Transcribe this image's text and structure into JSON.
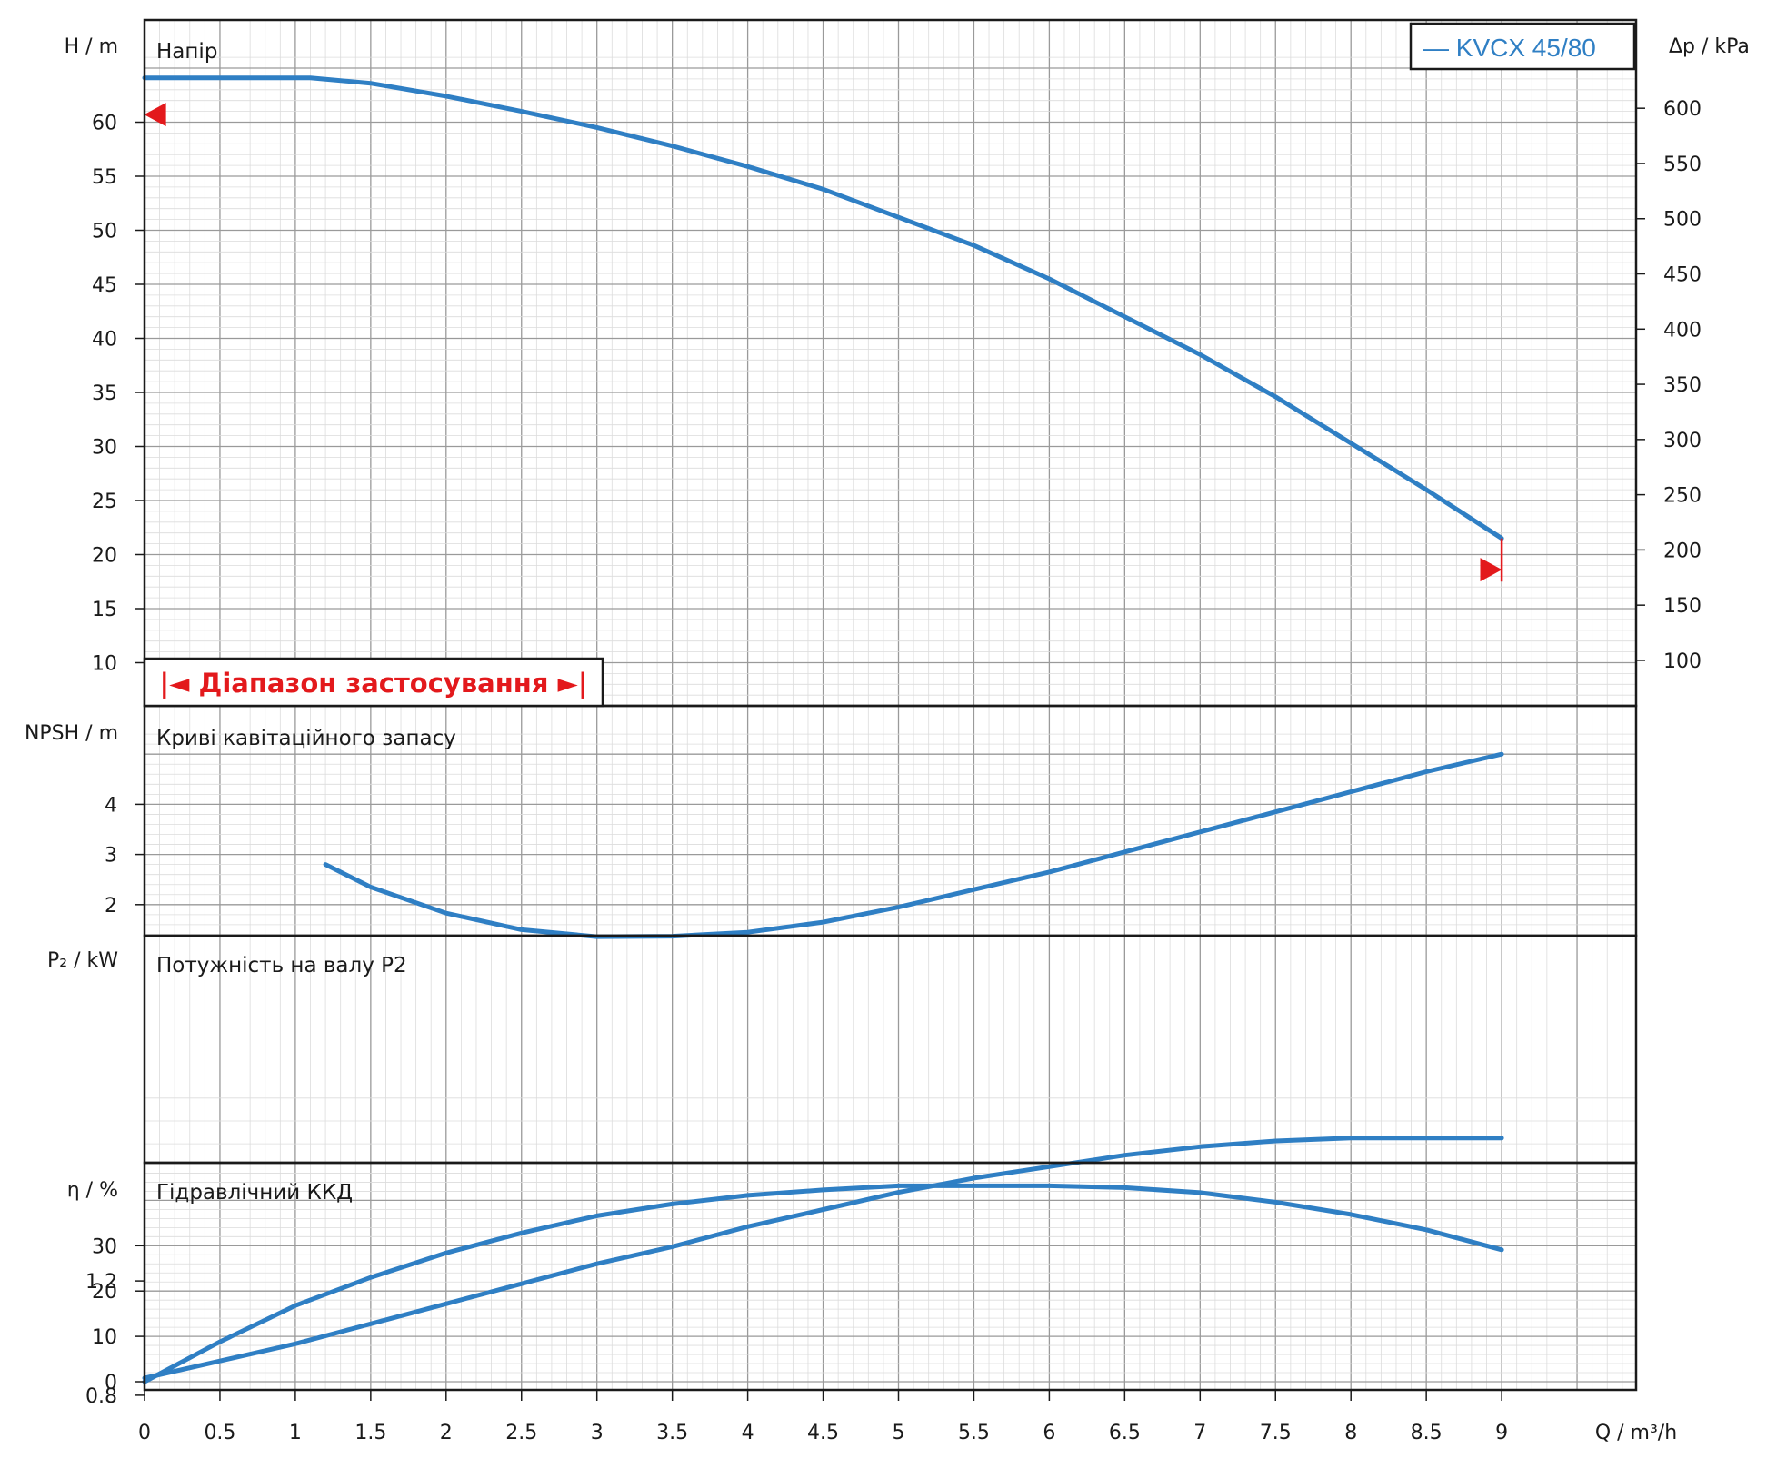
{
  "chart_data": {
    "type": "line",
    "colors": {
      "curve": "#2f7fc4",
      "range": "#e3191c",
      "grid": "#b4b4b4",
      "frame": "#1a1a1a"
    },
    "x": {
      "label": "Q / m³/h",
      "ticks": [
        0,
        0.5,
        1,
        1.5,
        2,
        2.5,
        3,
        3.5,
        4,
        4.5,
        5,
        5.5,
        6,
        6.5,
        7,
        7.5,
        8,
        8.5,
        9
      ],
      "tick_labels": [
        "0",
        "0.5",
        "1",
        "1.5",
        "2",
        "2.5",
        "3",
        "3.5",
        "4",
        "4.5",
        "5",
        "5.5",
        "6",
        "6.5",
        "7",
        "7.5",
        "8",
        "8.5",
        "9"
      ],
      "range": [
        0,
        10
      ]
    },
    "legend": {
      "label": "— KVCX 45/80",
      "position": "top-right"
    },
    "application_range": {
      "label": "|◄ Діапазон застосування ►|",
      "q_min": 0,
      "q_max": 9
    },
    "panels": [
      {
        "id": "head",
        "title": "Напір",
        "ylabel": "H / m",
        "ylim": [
          5,
          66
        ],
        "yticks": [
          10,
          15,
          20,
          25,
          30,
          35,
          40,
          45,
          50,
          55,
          60
        ],
        "ytick_labels": [
          "10",
          "15",
          "20",
          "25",
          "30",
          "35",
          "40",
          "45",
          "50",
          "55",
          "60"
        ],
        "secondary_axis": {
          "label": "Δp / kPa",
          "ticks": [
            100,
            150,
            200,
            250,
            300,
            350,
            400,
            450,
            500,
            550,
            600
          ],
          "tick_labels": [
            "100",
            "150",
            "200",
            "250",
            "300",
            "350",
            "400",
            "450",
            "500",
            "550",
            "600"
          ],
          "factor_kpa_per_m": 9.79
        },
        "series": {
          "x": [
            0,
            0.5,
            1,
            1.1,
            1.5,
            2,
            2.5,
            3,
            3.5,
            4,
            4.5,
            5,
            5.5,
            6,
            6.5,
            7,
            7.5,
            8,
            8.5,
            9
          ],
          "y": [
            64.1,
            64.1,
            64.1,
            64.1,
            63.6,
            62.4,
            61.0,
            59.5,
            57.8,
            55.9,
            53.8,
            51.2,
            48.6,
            45.5,
            42.0,
            38.5,
            34.6,
            30.3,
            26.0,
            21.5
          ]
        },
        "markers": [
          {
            "x": 0.07,
            "y": 60.7,
            "dir": "left"
          },
          {
            "x": 8.93,
            "y": 18.6,
            "dir": "right"
          }
        ],
        "limit_line": {
          "x": 9,
          "y": [
            17.5,
            21.5
          ]
        }
      },
      {
        "id": "npsh",
        "title": "Криві кавітаційного запасу",
        "ylabel": "NPSH / m",
        "ylim": [
          1.0,
          5.5
        ],
        "yticks": [
          2,
          3,
          4
        ],
        "ytick_labels": [
          "2",
          "3",
          "4"
        ],
        "series": {
          "x": [
            1.2,
            1.5,
            2,
            2.5,
            3,
            3.5,
            4,
            4.5,
            5,
            5.5,
            6,
            6.5,
            7,
            7.5,
            8,
            8.5,
            9
          ],
          "y": [
            2.8,
            2.35,
            1.83,
            1.5,
            1.36,
            1.37,
            1.45,
            1.65,
            1.95,
            2.3,
            2.65,
            3.05,
            3.45,
            3.85,
            4.25,
            4.65,
            5.0
          ]
        }
      },
      {
        "id": "power",
        "title": "Потужність на валу P2",
        "ylabel": "P₂ / kW",
        "ylim": [
          0.45,
          1.85
        ],
        "yticks": [
          0.8,
          1.2
        ],
        "ytick_labels": [
          "0.8",
          "1.2"
        ],
        "series": {
          "x": [
            0,
            0.5,
            1,
            1.5,
            2,
            2.5,
            3,
            3.5,
            4,
            4.5,
            5,
            5.5,
            6,
            6.5,
            7,
            7.5,
            8,
            8.5,
            9
          ],
          "y": [
            0.86,
            0.92,
            0.98,
            1.05,
            1.12,
            1.19,
            1.26,
            1.32,
            1.39,
            1.45,
            1.51,
            1.56,
            1.6,
            1.64,
            1.67,
            1.69,
            1.7,
            1.7,
            1.7
          ]
        }
      },
      {
        "id": "efficiency",
        "title": "Гідравлічний ККД",
        "ylabel": "η / %",
        "ylim": [
          -1,
          46
        ],
        "yticks": [
          0,
          10,
          20,
          30
        ],
        "ytick_labels": [
          "0",
          "10",
          "20",
          "30"
        ],
        "series": {
          "x": [
            0,
            0.5,
            1,
            1.5,
            2,
            2.5,
            3,
            3.5,
            4,
            4.5,
            5,
            5.5,
            6,
            6.5,
            7,
            7.5,
            8,
            8.5,
            9
          ],
          "y": [
            0,
            8.8,
            16.8,
            23,
            28.4,
            32.8,
            36.6,
            39.2,
            41.1,
            42.3,
            43.2,
            43.2,
            43.2,
            42.8,
            41.7,
            39.6,
            36.9,
            33.5,
            29.1
          ]
        }
      }
    ]
  }
}
